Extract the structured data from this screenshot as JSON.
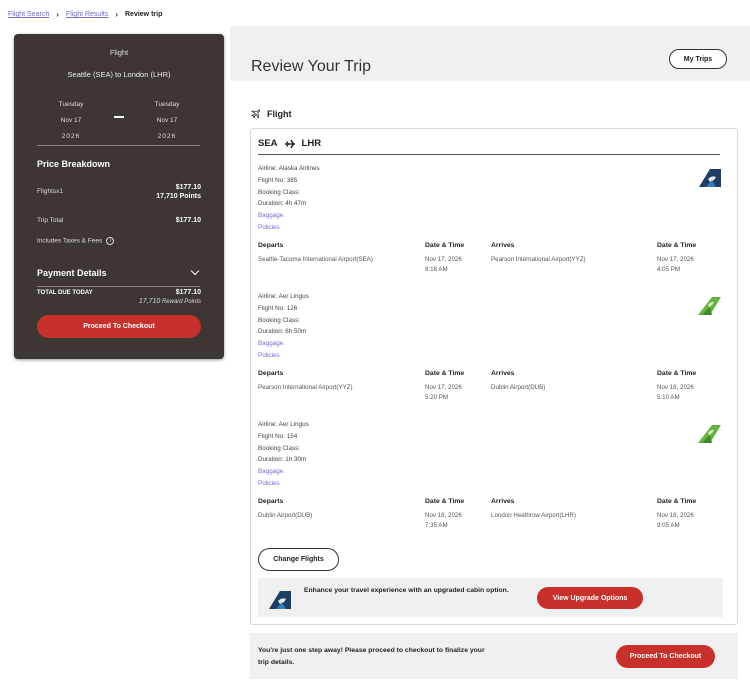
{
  "breadcrumb": {
    "items": [
      {
        "label": "Flight Search"
      },
      {
        "label": "Flight Results"
      },
      {
        "label": "Review trip"
      }
    ]
  },
  "page": {
    "title": "Review Your Trip",
    "my_trips_label": "My Trips"
  },
  "sidebar": {
    "flight_label": "Flight",
    "route": "Seattle (SEA) to London (LHR)",
    "depart": {
      "weekday": "Tuesday",
      "date": "Nov 17",
      "year": "2026"
    },
    "arrive": {
      "weekday": "Tuesday",
      "date": "Nov 17",
      "year": "2026"
    },
    "price_breakdown_title": "Price Breakdown",
    "flights_label": "Flightsx1",
    "flights_price": "$177.10",
    "flights_points": "17,710 Points",
    "trip_total_label": "Trip Total",
    "trip_total_value": "$177.10",
    "taxes_label": "Includes Taxes & Fees",
    "payment_title": "Payment Details",
    "total_due_label": "TOTAL DUE TODAY",
    "total_due_value": "$177.10",
    "reward_points_number": "17,710",
    "reward_points_suffix": "Reward Points",
    "checkout_label": "Proceed To Checkout"
  },
  "flight_section": {
    "heading": "Flight",
    "origin": "SEA",
    "destination": "LHR",
    "segments": [
      {
        "airline": "Airline: Alaska Airlines",
        "flight_no": "Flight No: 385",
        "booking_class": "Booking Class:",
        "duration": "Duration: 4h 47m",
        "baggage": "Baggage",
        "policies": "Policies",
        "departs_header": "Departs",
        "datetime_header": "Date & Time",
        "arrives_header": "Arrives",
        "datetime_header2": "Date & Time",
        "depart_airport": "Seattle-Tacoma International Airport(SEA)",
        "depart_date": "Nov 17, 2026",
        "depart_time": "8:18 AM",
        "arrive_airport": "Pearson International Airport(YYZ)",
        "arrive_date": "Nov 17, 2026",
        "arrive_time": "4:05 PM"
      },
      {
        "airline": "Airline: Aer Lingus",
        "flight_no": "Flight No: 126",
        "booking_class": "Booking Class:",
        "duration": "Duration: 6h 50m",
        "baggage": "Baggage",
        "policies": "Policies",
        "departs_header": "Departs",
        "datetime_header": "Date & Time",
        "arrives_header": "Arrives",
        "datetime_header2": "Date & Time",
        "depart_airport": "Pearson International Airport(YYZ)",
        "depart_date": "Nov 17, 2026",
        "depart_time": "5:20 PM",
        "arrive_airport": "Dublin Airport(DUB)",
        "arrive_date": "Nov 18, 2026",
        "arrive_time": "5:10 AM"
      },
      {
        "airline": "Airline: Aer Lingus",
        "flight_no": "Flight No: 154",
        "booking_class": "Booking Class:",
        "duration": "Duration: 1h 30m",
        "baggage": "Baggage",
        "policies": "Policies",
        "departs_header": "Departs",
        "datetime_header": "Date & Time",
        "arrives_header": "Arrives",
        "datetime_header2": "Date & Time",
        "depart_airport": "Dublin Airport(DUB)",
        "depart_date": "Nov 18, 2026",
        "depart_time": "7:35 AM",
        "arrive_airport": "London Heathrow Airport(LHR)",
        "arrive_date": "Nov 18, 2026",
        "arrive_time": "9:05 AM"
      }
    ],
    "change_flights_label": "Change Flights",
    "upgrade_text": "Enhance your travel experience with an upgraded cabin option.",
    "upgrade_button_label": "View Upgrade Options"
  },
  "footer_bar": {
    "text": "You're just one step away! Please proceed to checkout to finalize your trip details.",
    "checkout_label": "Proceed To Checkout"
  },
  "colors": {
    "accent_red": "#c8302c",
    "sidebar_bg": "#3d3632",
    "link": "#6e6ec8"
  }
}
